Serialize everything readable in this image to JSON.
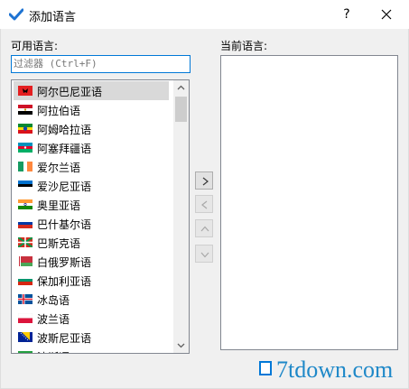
{
  "window": {
    "title": "添加语言",
    "help_label": "?",
    "icon": "checkmark-icon"
  },
  "available": {
    "label": "可用语言:",
    "filter_placeholder": "过滤器 (Ctrl+F)",
    "filter_value": "",
    "items": [
      {
        "label": "阿尔巴尼亚语",
        "flag": "albania",
        "selected": true
      },
      {
        "label": "阿拉伯语",
        "flag": "egypt",
        "selected": false
      },
      {
        "label": "阿姆哈拉语",
        "flag": "ethiopia",
        "selected": false
      },
      {
        "label": "阿塞拜疆语",
        "flag": "azerbaijan",
        "selected": false
      },
      {
        "label": "爱尔兰语",
        "flag": "ireland",
        "selected": false
      },
      {
        "label": "爱沙尼亚语",
        "flag": "estonia",
        "selected": false
      },
      {
        "label": "奥里亚语",
        "flag": "india",
        "selected": false
      },
      {
        "label": "巴什基尔语",
        "flag": "russia",
        "selected": false
      },
      {
        "label": "巴斯克语",
        "flag": "basque",
        "selected": false
      },
      {
        "label": "白俄罗斯语",
        "flag": "belarus",
        "selected": false
      },
      {
        "label": "保加利亚语",
        "flag": "bulgaria",
        "selected": false
      },
      {
        "label": "冰岛语",
        "flag": "iceland",
        "selected": false
      },
      {
        "label": "波兰语",
        "flag": "poland",
        "selected": false
      },
      {
        "label": "波斯尼亚语",
        "flag": "bosnia",
        "selected": false
      },
      {
        "label": "波斯语",
        "flag": "iran",
        "selected": false
      }
    ]
  },
  "current": {
    "label": "当前语言:",
    "items": []
  },
  "move_buttons": [
    {
      "name": "add-language-button",
      "icon": "chevron-right-icon",
      "enabled": true
    },
    {
      "name": "remove-language-button",
      "icon": "chevron-left-icon",
      "enabled": false
    },
    {
      "name": "move-up-button",
      "icon": "chevron-up-icon",
      "enabled": false
    },
    {
      "name": "move-down-button",
      "icon": "chevron-down-icon",
      "enabled": false
    }
  ],
  "watermark": "7tdown.com",
  "colors": {
    "accent": "#0078d7",
    "selection": "#d9d9d9",
    "watermark": "#1e88c8"
  }
}
